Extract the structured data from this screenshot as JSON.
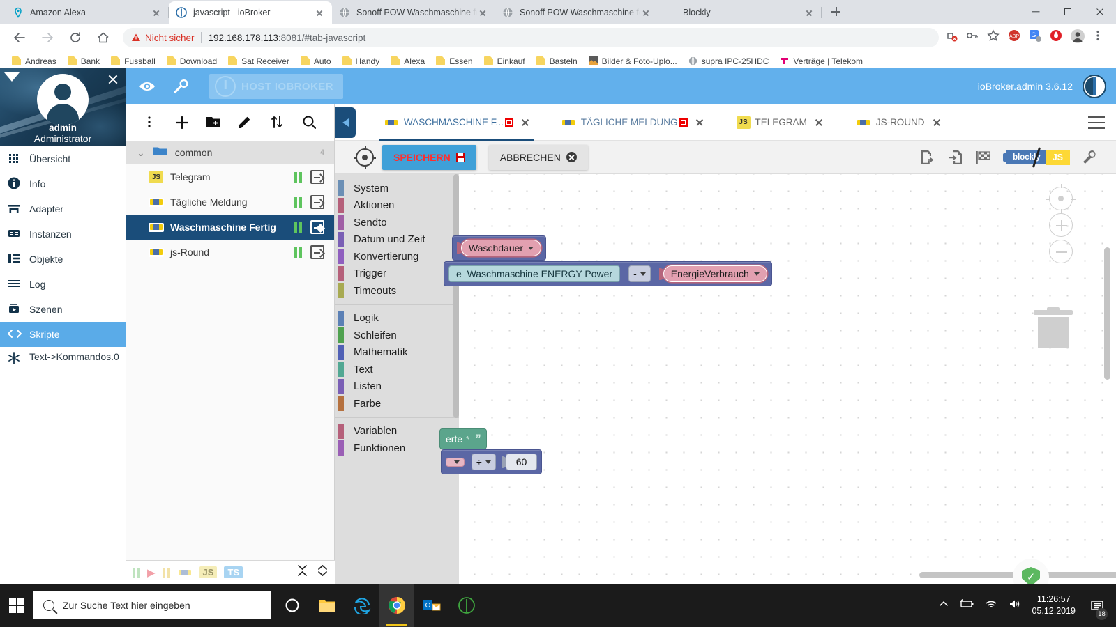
{
  "browser": {
    "tabs": [
      {
        "title": "Amazon Alexa",
        "icon": "location-pin-icon",
        "active": false
      },
      {
        "title": "javascript - ioBroker",
        "icon": "iobroker-icon",
        "active": true
      },
      {
        "title": "Sonoff POW Waschmaschine fert",
        "icon": "globe-icon",
        "active": false
      },
      {
        "title": "Sonoff POW Waschmaschine fert",
        "icon": "globe-icon",
        "active": false
      },
      {
        "title": "Blockly",
        "icon": "blank-icon",
        "active": false
      }
    ],
    "new_tab_label": "+",
    "window_controls": [
      "minimize",
      "restore",
      "close"
    ],
    "address": {
      "security_label": "Nicht sicher",
      "host": "192.168.178.113",
      "port": ":8081",
      "path": "/#tab-javascript"
    },
    "nav_icons": [
      "back-icon",
      "forward-icon",
      "reload-icon",
      "home-icon"
    ],
    "right_icons": [
      "extensions-blocked-icon",
      "key-icon",
      "bookmark-star-icon",
      "adblock-icon",
      "google-translate-icon",
      "avira-icon",
      "profile-avatar-icon",
      "chrome-menu-icon"
    ],
    "bookmarks": [
      {
        "label": "Andreas",
        "icon": "folder-icon"
      },
      {
        "label": "Bank",
        "icon": "folder-icon"
      },
      {
        "label": "Fussball",
        "icon": "folder-icon"
      },
      {
        "label": "Download",
        "icon": "folder-icon"
      },
      {
        "label": "Sat Receiver",
        "icon": "folder-icon"
      },
      {
        "label": "Auto",
        "icon": "folder-icon"
      },
      {
        "label": "Handy",
        "icon": "folder-icon"
      },
      {
        "label": "Alexa",
        "icon": "folder-icon"
      },
      {
        "label": "Essen",
        "icon": "folder-icon"
      },
      {
        "label": "Einkauf",
        "icon": "folder-icon"
      },
      {
        "label": "Basteln",
        "icon": "folder-icon"
      },
      {
        "label": "Bilder & Foto-Uplo...",
        "icon": "picture-icon"
      },
      {
        "label": "supra IPC-25HDC",
        "icon": "globe-icon"
      },
      {
        "label": "Verträge | Telekom",
        "icon": "telekom-icon"
      }
    ]
  },
  "sidebar": {
    "user_name": "admin",
    "user_role": "Administrator",
    "collapse_icon": "caret-down-icon",
    "close_icon": "close-icon",
    "items": [
      {
        "label": "Übersicht",
        "icon": "grid-icon",
        "active": false
      },
      {
        "label": "Info",
        "icon": "info-icon",
        "active": false
      },
      {
        "label": "Adapter",
        "icon": "store-icon",
        "active": false
      },
      {
        "label": "Instanzen",
        "icon": "instances-icon",
        "active": false
      },
      {
        "label": "Objekte",
        "icon": "objects-list-icon",
        "active": false
      },
      {
        "label": "Log",
        "icon": "log-lines-icon",
        "active": false
      },
      {
        "label": "Szenen",
        "icon": "scenes-icon",
        "active": false
      },
      {
        "label": "Skripte",
        "icon": "code-brackets-icon",
        "active": true
      },
      {
        "label": "Text->Kommandos.0",
        "icon": "snowflake-icon",
        "active": false
      }
    ]
  },
  "header": {
    "eye_icon": "eye-icon",
    "wrench_icon": "wrench-icon",
    "host_label": "HOST IOBROKER",
    "version_label": "ioBroker.admin 3.6.12",
    "logo_icon": "iobroker-logo-icon"
  },
  "scripts_panel": {
    "toolbar_icons": [
      "more-vertical-icon",
      "add-icon",
      "new-folder-icon",
      "edit-pencil-icon",
      "sort-icon",
      "search-icon"
    ],
    "folder": {
      "name": "common",
      "count": "4",
      "expand_icon": "chevron-down-icon",
      "folder_icon": "folder-open-icon"
    },
    "scripts": [
      {
        "name": "Telegram",
        "type": "js",
        "state_icon": "pause-icon",
        "run_icon": "enter-arrow-icon",
        "selected": false
      },
      {
        "name": "Tägliche Meldung",
        "type": "blockly",
        "state_icon": "pause-icon",
        "run_icon": "enter-arrow-icon",
        "selected": false
      },
      {
        "name": "Waschmaschine Fertig",
        "type": "blockly",
        "state_icon": "pause-icon",
        "run_icon": "enter-arrow-icon",
        "selected": true
      },
      {
        "name": "js-Round",
        "type": "blockly",
        "state_icon": "pause-icon",
        "run_icon": "enter-arrow-icon",
        "selected": false
      }
    ],
    "footer": {
      "filter_icons": [
        "pause-filter-icon",
        "play-filter-icon",
        "pause-filter-icon",
        "blockly-filter-icon"
      ],
      "js_label": "JS",
      "ts_label": "TS",
      "collapse_all_icon": "collapse-all-icon",
      "expand_all_icon": "expand-all-icon"
    }
  },
  "editor": {
    "back_icon": "back-arrow-icon",
    "menu_icon": "hamburger-menu-icon",
    "tabs": [
      {
        "label": "WASCHMASCHINE F...",
        "icon": "blockly-icon",
        "modified": true,
        "active": true
      },
      {
        "label": "TÄGLICHE MELDUNG",
        "icon": "blockly-icon",
        "modified": true,
        "active": false
      },
      {
        "label": "TELEGRAM",
        "icon": "js-icon",
        "modified": false,
        "active": false
      },
      {
        "label": "JS-ROUND",
        "icon": "blockly-icon",
        "modified": false,
        "active": false
      }
    ],
    "commands": {
      "locate_icon": "target-icon",
      "save_label": "SPEICHERN",
      "save_icon": "floppy-icon",
      "cancel_label": "ABBRECHEN",
      "cancel_icon": "close-circle-icon",
      "right_icons": [
        "export-icon",
        "import-icon",
        "checkered-flag-icon",
        "settings-wrench-icon"
      ],
      "toggle": {
        "blockly_label": "blockly",
        "js_label": "JS"
      }
    }
  },
  "blockly": {
    "categories": [
      {
        "label": "System",
        "color": "#6b8fb5"
      },
      {
        "label": "Aktionen",
        "color": "#b5607a"
      },
      {
        "label": "Sendto",
        "color": "#a05fa5"
      },
      {
        "label": "Datum und Zeit",
        "color": "#7a5fb5"
      },
      {
        "label": "Konvertierung",
        "color": "#8f5fbf"
      },
      {
        "label": "Trigger",
        "color": "#b5607a"
      },
      {
        "label": "Timeouts",
        "color": "#a8aa52"
      },
      {
        "sep": true
      },
      {
        "label": "Logik",
        "color": "#5b80b5"
      },
      {
        "label": "Schleifen",
        "color": "#4fa14f"
      },
      {
        "label": "Mathematik",
        "color": "#5060b5"
      },
      {
        "label": "Text",
        "color": "#52a893"
      },
      {
        "label": "Listen",
        "color": "#7a5fb5"
      },
      {
        "label": "Farbe",
        "color": "#b5713f"
      },
      {
        "sep": true
      },
      {
        "label": "Variablen",
        "color": "#b5607a"
      },
      {
        "label": "Funktionen",
        "color": "#9a5fb5"
      }
    ],
    "blocks": {
      "waschdauer_var": "Waschdauer",
      "energy_power_field": "e_Waschmaschine ENERGY  Power",
      "minus_operator": "-",
      "energieverbrauch_var": "EnergieVerbrauch",
      "text_fragment": "erte",
      "text_star": "*",
      "quote_glyph": "”",
      "divide_operator": "÷",
      "number_value": "60"
    },
    "controls": [
      "center-target-icon",
      "zoom-in-icon",
      "zoom-out-icon",
      "trash-icon"
    ],
    "shield_icon": "shield-check-icon"
  },
  "taskbar": {
    "start_icon": "windows-start-icon",
    "search_placeholder": "Zur Suche Text hier eingeben",
    "search_icon": "search-icon",
    "apps": [
      "cortana-icon",
      "file-explorer-icon",
      "edge-icon",
      "chrome-icon",
      "outlook-icon",
      "iobroker-app-icon"
    ],
    "tray_icons": [
      "chevron-up-icon",
      "battery-icon",
      "wifi-icon",
      "volume-icon"
    ],
    "time": "11:26:57",
    "date": "05.12.2019",
    "notification_count": "18",
    "notification_icon": "notification-icon"
  }
}
